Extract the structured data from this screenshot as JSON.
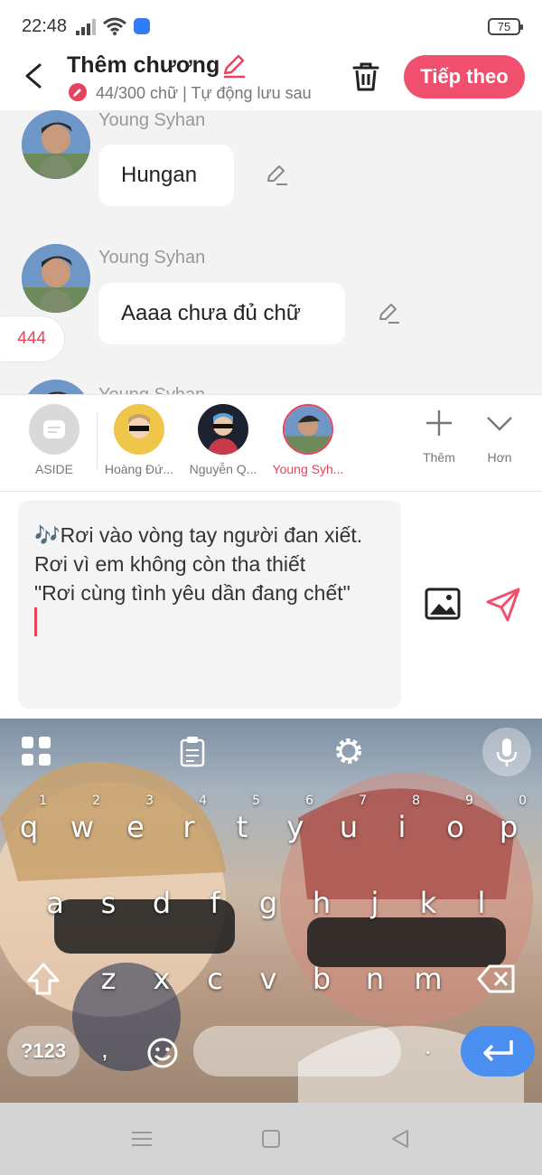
{
  "status_bar": {
    "time": "22:48",
    "battery": "75"
  },
  "header": {
    "title": "Thêm chương",
    "subtitle": "44/300 chữ | Tự động lưu sau",
    "next_label": "Tiếp theo"
  },
  "messages": [
    {
      "author": "Young Syhan",
      "text": "Hungan"
    },
    {
      "author": "Young Syhan",
      "text": "Aaaa chưa đủ chữ"
    },
    {
      "author": "Young Syhan",
      "text": ""
    }
  ],
  "count_pill": "444",
  "characters": [
    {
      "name": "ASIDE"
    },
    {
      "name": "Hoàng Đứ..."
    },
    {
      "name": "Nguyễn Q..."
    },
    {
      "name": "Young Syh...",
      "selected": true
    }
  ],
  "tools": {
    "add_label": "Thêm",
    "more_label": "Hơn"
  },
  "composer": {
    "text": "🎶Rơi vào vòng tay người đan xiết.\nRơi vì em không còn tha thiết\n\"Rơi cùng tình yêu dần đang chết\""
  },
  "keyboard": {
    "row1": [
      {
        "key": "q",
        "num": "1"
      },
      {
        "key": "w",
        "num": "2"
      },
      {
        "key": "e",
        "num": "3"
      },
      {
        "key": "r",
        "num": "4"
      },
      {
        "key": "t",
        "num": "5"
      },
      {
        "key": "y",
        "num": "6"
      },
      {
        "key": "u",
        "num": "7"
      },
      {
        "key": "i",
        "num": "8"
      },
      {
        "key": "o",
        "num": "9"
      },
      {
        "key": "p",
        "num": "0"
      }
    ],
    "row2": [
      "a",
      "s",
      "d",
      "f",
      "g",
      "h",
      "j",
      "k",
      "l"
    ],
    "row3": [
      "z",
      "x",
      "c",
      "v",
      "b",
      "n",
      "m"
    ],
    "symbols_label": "?123",
    "comma": ",",
    "period": "."
  },
  "colors": {
    "accent": "#f0506e",
    "enter": "#4a8ef0"
  }
}
